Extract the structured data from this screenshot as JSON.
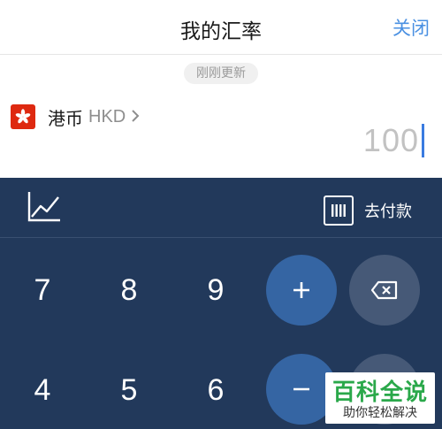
{
  "header": {
    "title": "我的汇率",
    "close_label": "关闭"
  },
  "status": {
    "update_text": "刚刚更新"
  },
  "currency": {
    "name": "港币",
    "code": "HKD",
    "flag": "hong-kong-flag",
    "flag_color": "#de2910"
  },
  "amount": {
    "value": "100"
  },
  "toolbar": {
    "trend_icon": "trend-chart-icon",
    "pay_icon": "barcode-icon",
    "pay_label": "去付款"
  },
  "keypad": {
    "row1": [
      "7",
      "8",
      "9"
    ],
    "row2": [
      "4",
      "5",
      "6"
    ],
    "plus": "+",
    "minus": "−",
    "backspace_icon": "backspace-icon"
  },
  "watermark": {
    "title": "百科全说",
    "subtitle": "助你轻松解决"
  },
  "colors": {
    "keypad_bg": "#22395b",
    "accent_blue": "#3565a3",
    "link": "#4a90e2"
  }
}
